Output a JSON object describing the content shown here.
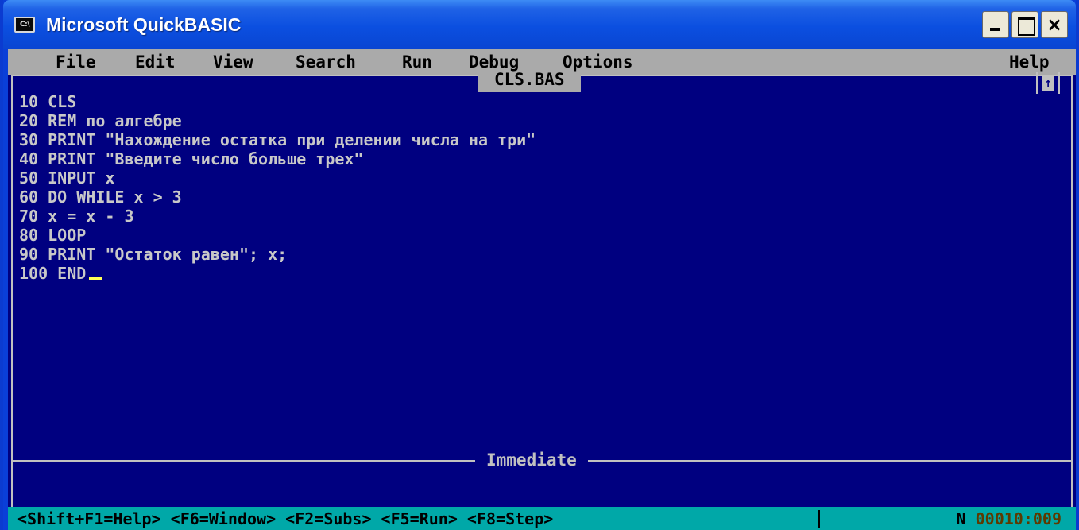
{
  "window": {
    "title": "Microsoft QuickBASIC",
    "icon_label": "C:\\",
    "close_label": "×"
  },
  "menu": {
    "items": [
      "File",
      "Edit",
      "View",
      "Search",
      "Run",
      "Debug",
      "Options"
    ],
    "help": "Help"
  },
  "editor": {
    "filename": "CLS.BAS",
    "scroll_arrow": "↑",
    "lines": [
      "10 CLS",
      "20 REM по алгебре",
      "30 PRINT \"Нахождение остатка при делении числа на три\"",
      "40 PRINT \"Введите число больше трех\"",
      "50 INPUT x",
      "60 DO WHILE x > 3",
      "70 x = x - 3",
      "80 LOOP",
      "90 PRINT \"Остаток равен\"; x;",
      "100 END"
    ]
  },
  "immediate": {
    "label": "Immediate"
  },
  "statusbar": {
    "keys": "<Shift+F1=Help> <F6=Window> <F2=Subs> <F5=Run> <F8=Step>",
    "mode": "N",
    "position": "00010:009"
  },
  "colors": {
    "screen_bg": "#000080",
    "menu_bg": "#aaaaaa",
    "status_bg": "#00a8a8",
    "cursor": "#ffff55"
  },
  "icons": {
    "app": "console-icon",
    "minimize": "minimize-icon",
    "maximize": "maximize-icon",
    "close": "close-icon"
  }
}
